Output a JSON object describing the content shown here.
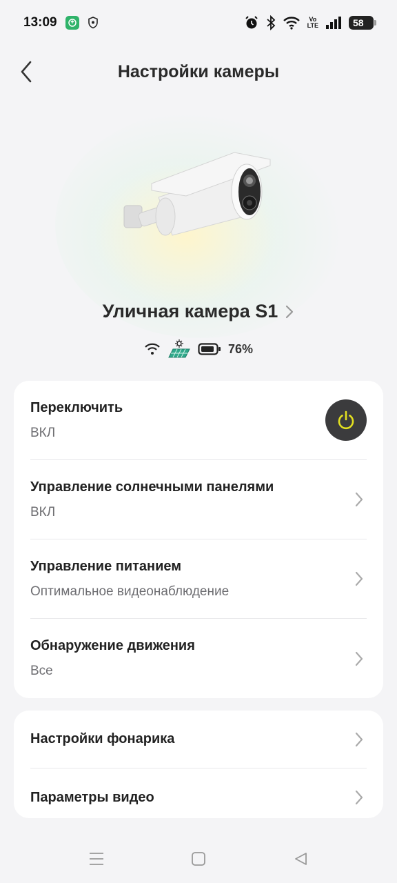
{
  "status_bar": {
    "time": "13:09",
    "volte_top": "Vo",
    "volte_bottom": "LTE",
    "battery_level": "58"
  },
  "header": {
    "title": "Настройки камеры"
  },
  "device": {
    "name": "Уличная камера S1",
    "battery_percent": "76%"
  },
  "settings_group_1": [
    {
      "title": "Переключить",
      "value": "ВКЛ",
      "control": "power-toggle"
    },
    {
      "title": "Управление солнечными панелями",
      "value": "ВКЛ",
      "control": "chevron"
    },
    {
      "title": "Управление питанием",
      "value": "Оптимальное видеонаблюдение",
      "control": "chevron"
    },
    {
      "title": "Обнаружение движения",
      "value": "Все",
      "control": "chevron"
    }
  ],
  "settings_group_2": [
    {
      "title": "Настройки фонарика",
      "control": "chevron"
    },
    {
      "title": "Параметры видео",
      "control": "chevron"
    }
  ],
  "colors": {
    "power_button_bg": "#3b3b3d",
    "power_icon": "#e3e020",
    "solar_panel": "#2fa88a"
  },
  "icons": {
    "back": "back-arrow-icon",
    "wifi": "wifi-icon",
    "solar": "solar-panel-icon",
    "battery": "battery-icon",
    "power": "power-icon",
    "chevron": "chevron-right-icon"
  }
}
